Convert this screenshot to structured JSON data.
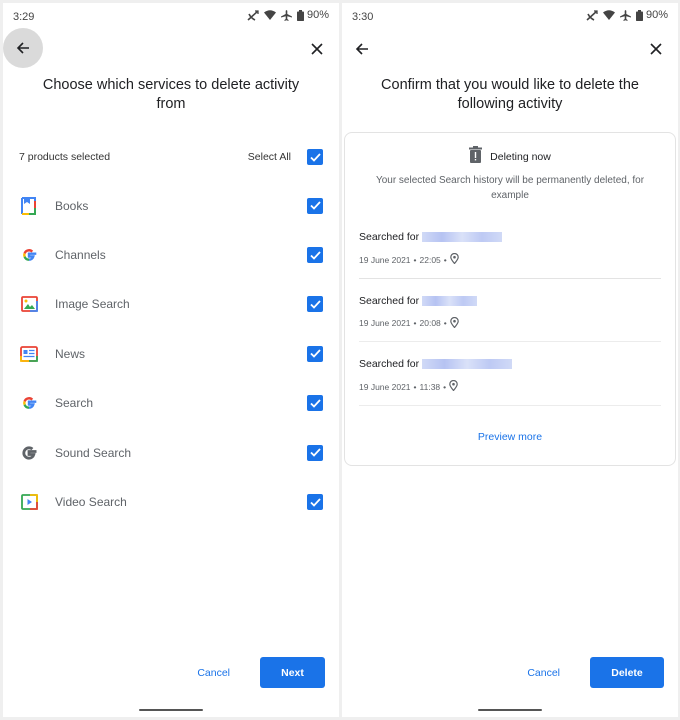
{
  "left_screen": {
    "status": {
      "time": "3:29",
      "battery": "90%"
    },
    "title": "Choose which services to delete activity from",
    "count_label": "7 products selected",
    "select_all_label": "Select All",
    "select_all_checked": true,
    "products": [
      {
        "label": "Books",
        "icon": "google-play-books-icon",
        "checked": true
      },
      {
        "label": "Channels",
        "icon": "google-g-icon",
        "checked": true
      },
      {
        "label": "Image Search",
        "icon": "image-search-icon",
        "checked": true
      },
      {
        "label": "News",
        "icon": "google-news-icon",
        "checked": true
      },
      {
        "label": "Search",
        "icon": "google-g-icon",
        "checked": true
      },
      {
        "label": "Sound Search",
        "icon": "google-g-grey-icon",
        "checked": true
      },
      {
        "label": "Video Search",
        "icon": "video-search-icon",
        "checked": true
      }
    ],
    "cancel_label": "Cancel",
    "next_label": "Next"
  },
  "right_screen": {
    "status": {
      "time": "3:30",
      "battery": "90%"
    },
    "title": "Confirm that you would like to delete the following activity",
    "card": {
      "heading": "Deleting now",
      "description": "Your selected Search history will be permanently deleted, for example",
      "activities": [
        {
          "prefix": "Searched for",
          "query": "[redacted]",
          "date": "19 June 2021",
          "time": "22:05"
        },
        {
          "prefix": "Searched for",
          "query": "[redacted]",
          "date": "19 June 2021",
          "time": "20:08"
        },
        {
          "prefix": "Searched for",
          "query": "[redacted]",
          "date": "19 June 2021",
          "time": "11:38"
        }
      ],
      "preview_more_label": "Preview more"
    },
    "cancel_label": "Cancel",
    "delete_label": "Delete"
  },
  "colors": {
    "accent": "#1a73e8",
    "text_primary": "#202124",
    "text_secondary": "#5f6368",
    "background": "#efefef"
  }
}
